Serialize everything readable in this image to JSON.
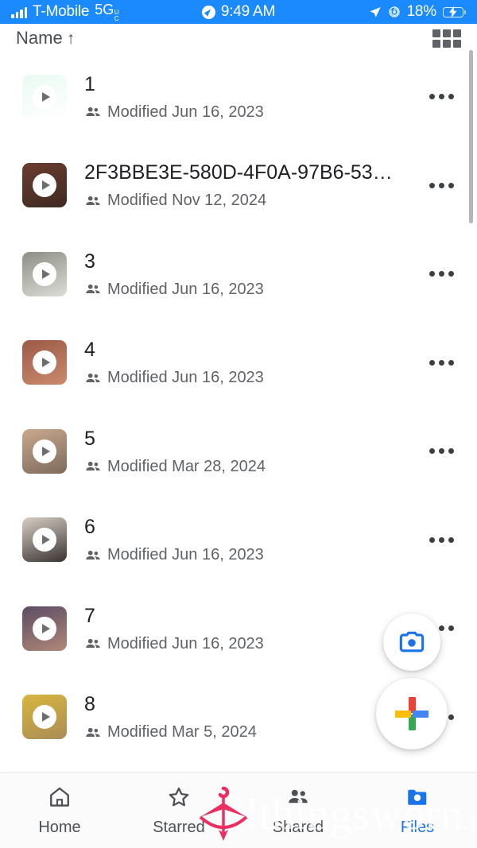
{
  "status_bar": {
    "carrier": "T-Mobile",
    "network_type": "5G",
    "network_suffix_top": "U",
    "network_suffix_bottom": "C",
    "time": "9:49 AM",
    "battery_percent": "18%",
    "icons": [
      "signal-bars-icon",
      "navigation-compass-icon",
      "location-arrow-icon",
      "rotation-lock-icon",
      "battery-charging-icon"
    ],
    "accent_color": "#1c8aff",
    "battery_fill_color": "#ff2d26"
  },
  "sort_header": {
    "label": "Name",
    "arrow": "↑",
    "view_toggle": "grid-view-icon"
  },
  "files": [
    {
      "name": "1",
      "modified": "Modified Jun 16, 2023",
      "thumb_top": "#eafaf2",
      "thumb_bottom": "#ffffff",
      "shared": true,
      "media": "video"
    },
    {
      "name": "2F3BBE3E-580D-4F0A-97B6-53…",
      "modified": "Modified Nov 12, 2024",
      "thumb_top": "#6b3d2e",
      "thumb_bottom": "#3e2a22",
      "shared": true,
      "media": "video"
    },
    {
      "name": "3",
      "modified": "Modified Jun 16, 2023",
      "thumb_top": "#8d8f86",
      "thumb_bottom": "#dcdcd6",
      "shared": true,
      "media": "video"
    },
    {
      "name": "4",
      "modified": "Modified Jun 16, 2023",
      "thumb_top": "#9c5a46",
      "thumb_bottom": "#c98a6e",
      "shared": true,
      "media": "video"
    },
    {
      "name": "5",
      "modified": "Modified Mar 28, 2024",
      "thumb_top": "#c9a98e",
      "thumb_bottom": "#7d6a5b",
      "shared": true,
      "media": "video"
    },
    {
      "name": "6",
      "modified": "Modified Jun 16, 2023",
      "thumb_top": "#d8cfc6",
      "thumb_bottom": "#3a3330",
      "shared": true,
      "media": "video"
    },
    {
      "name": "7",
      "modified": "Modified Jun 16, 2023",
      "thumb_top": "#5b4c63",
      "thumb_bottom": "#b08878",
      "shared": true,
      "media": "video"
    },
    {
      "name": "8",
      "modified": "Modified Mar 5, 2024",
      "thumb_top": "#d9b53f",
      "thumb_bottom": "#a98d55",
      "shared": true,
      "media": "video"
    }
  ],
  "fabs": {
    "camera_label": "camera-icon",
    "camera_color": "#1a73e8",
    "plus_label": "add-new-icon",
    "plus_colors": [
      "#ea4335",
      "#fbbc04",
      "#4285f4",
      "#34a853"
    ]
  },
  "watermark": {
    "text": "allthingsworn",
    "suffix": ".com",
    "logo_color": "#ec2f63"
  },
  "bottom_nav": {
    "items": [
      {
        "label": "Home",
        "icon": "home-icon",
        "active": false
      },
      {
        "label": "Starred",
        "icon": "star-icon",
        "active": false
      },
      {
        "label": "Shared",
        "icon": "people-icon",
        "active": false
      },
      {
        "label": "Files",
        "icon": "folder-icon",
        "active": true
      }
    ],
    "active_color": "#1a73e8",
    "inactive_color": "#4d5156"
  }
}
